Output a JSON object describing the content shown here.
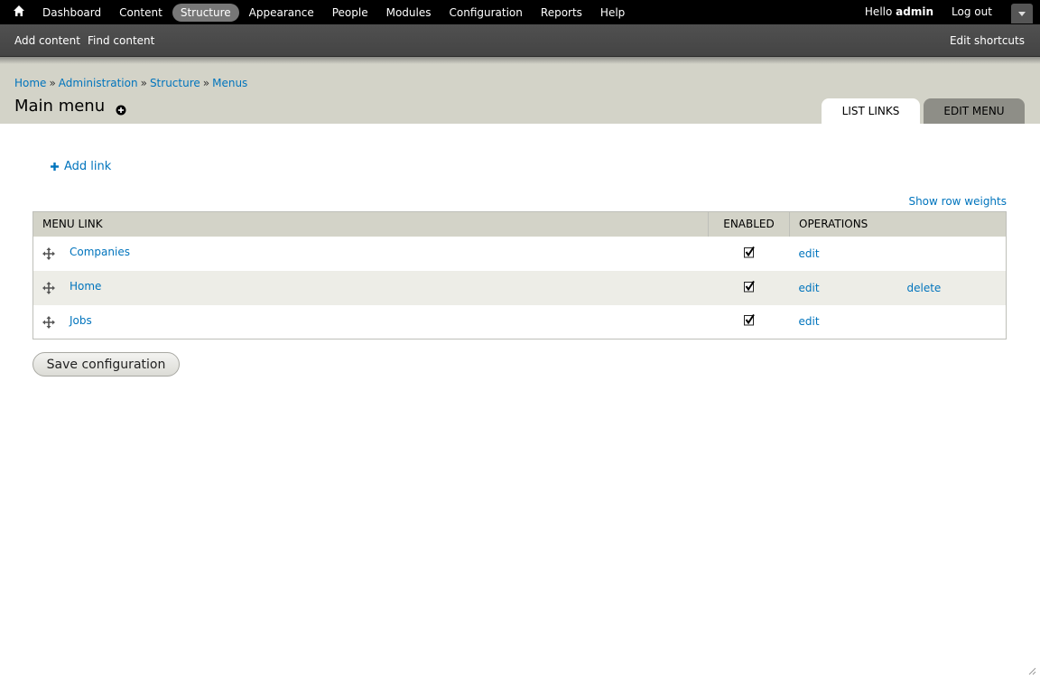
{
  "toolbar": {
    "items": [
      {
        "label": "Dashboard"
      },
      {
        "label": "Content"
      },
      {
        "label": "Structure"
      },
      {
        "label": "Appearance"
      },
      {
        "label": "People"
      },
      {
        "label": "Modules"
      },
      {
        "label": "Configuration"
      },
      {
        "label": "Reports"
      },
      {
        "label": "Help"
      }
    ],
    "active": "Structure",
    "greeting": "Hello ",
    "username": "admin",
    "logout": "Log out"
  },
  "shortcuts": {
    "items": [
      {
        "label": "Add content"
      },
      {
        "label": "Find content"
      }
    ],
    "edit": "Edit shortcuts"
  },
  "breadcrumb": {
    "items": [
      {
        "label": "Home"
      },
      {
        "label": "Administration"
      },
      {
        "label": "Structure"
      },
      {
        "label": "Menus"
      }
    ],
    "separator": "»"
  },
  "page": {
    "title": "Main menu"
  },
  "tabs": [
    {
      "label": "List links"
    },
    {
      "label": "Edit menu"
    }
  ],
  "actions": {
    "add_link": "Add link",
    "show_row_weights": "Show row weights"
  },
  "table": {
    "headers": {
      "link": "Menu link",
      "enabled": "Enabled",
      "operations": "Operations"
    },
    "rows": [
      {
        "title": "Companies",
        "enabled": true,
        "edit": "edit",
        "delete": ""
      },
      {
        "title": "Home",
        "enabled": true,
        "edit": "edit",
        "delete": "delete"
      },
      {
        "title": "Jobs",
        "enabled": true,
        "edit": "edit",
        "delete": ""
      }
    ]
  },
  "form": {
    "save_label": "Save configuration"
  },
  "colors": {
    "toolbar_bg": "#000000",
    "shortcut_bg": "#4a4a4a",
    "header_bg": "#d3d3c8",
    "link": "#0074bd",
    "active_tab": "#ffffff",
    "inactive_tab": "#8e8e87"
  },
  "icons": {
    "home": "home-icon",
    "title_add": "plus-circle-icon",
    "add_link": "plus-icon",
    "drag": "drag-handle-icon",
    "enabled": "checkbox-checked-icon",
    "drawer": "chevron-down-icon"
  }
}
